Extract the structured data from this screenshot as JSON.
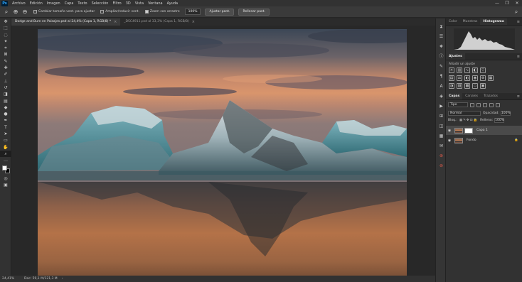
{
  "menu": {
    "logo": "Ps",
    "items": [
      "Archivo",
      "Edición",
      "Imagen",
      "Capa",
      "Texto",
      "Selección",
      "Filtro",
      "3D",
      "Vista",
      "Ventana",
      "Ayuda"
    ],
    "window_controls": [
      "—",
      "❐",
      "✕"
    ]
  },
  "options": {
    "tool_icon": "zoom-icon",
    "resize_windows_label": "Cambiar tamaño vent. para ajustar",
    "zoom_all_label": "Ampliar/reducir vent.",
    "scrubby_zoom_label": "Zoom con arrastre",
    "zoom_value": "100%",
    "fit_screen_label": "Ajustar pant.",
    "fill_screen_label": "Rellenar pant."
  },
  "tabs": [
    {
      "label": "Dodge and Burn en Paisajes.psd al 24,4% (Capa 1, RGB/8) *",
      "close": "×"
    },
    {
      "label": "_DSC4911.psd al 33,3% (Capa 1, RGB/8)",
      "close": "×"
    }
  ],
  "status": {
    "zoom": "24,41%",
    "doc": "Doc: 59,1 M/121,3 M",
    "arrow": "›"
  },
  "panels": {
    "top_tabs": [
      "Color",
      "Muestras",
      "Histograma"
    ],
    "top_active": 2,
    "adjust_title": "Ajustes",
    "adjust_sub": "Añadir un ajuste",
    "layer_tabs": [
      "Capas",
      "Canales",
      "Trazados"
    ],
    "kind_value": "Tipo",
    "blend_mode": "Normal",
    "opacity_label": "Opacidad:",
    "opacity_value": "100%",
    "lock_label": "Bloq.:",
    "fill_label": "Relleno:",
    "fill_value": "100%",
    "layers": [
      {
        "name": "Capa 1",
        "selected": true
      },
      {
        "name": "Fondo",
        "selected": false
      }
    ]
  },
  "colors": {
    "menubar": "#323232",
    "optionsbar": "#3a3a3a",
    "canvas_bg": "#282828",
    "panel_bg": "#323232",
    "accent": "#31a8ff"
  }
}
